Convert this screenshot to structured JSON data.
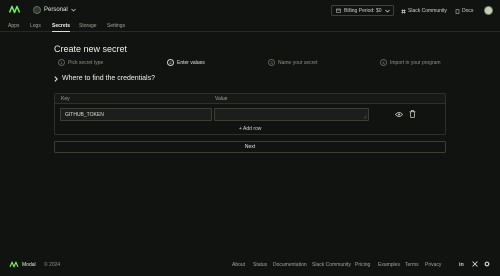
{
  "header": {
    "workspace": "Personal",
    "billing_label": "Billing Period: $0",
    "slack": "Slack Community",
    "docs": "Docs"
  },
  "nav": {
    "tabs": [
      {
        "label": "Apps"
      },
      {
        "label": "Logs"
      },
      {
        "label": "Secrets"
      },
      {
        "label": "Storage"
      },
      {
        "label": "Settings"
      }
    ],
    "active": "Secrets"
  },
  "page": {
    "title": "Create new secret",
    "steps": [
      {
        "num": "1",
        "label": "Pick secret type"
      },
      {
        "num": "2",
        "label": "Enter values"
      },
      {
        "num": "3",
        "label": "Name your secret"
      },
      {
        "num": "4",
        "label": "Import in your program"
      }
    ],
    "active_step": "2",
    "where": "Where to find the credentials?",
    "table": {
      "key_header": "Key",
      "value_header": "Value",
      "rows": [
        {
          "key": "GITHUB_TOKEN",
          "value": ""
        }
      ]
    },
    "add_row": "+ Add row",
    "next": "Next"
  },
  "footer": {
    "brand": "Modal",
    "copyright": "© 2024",
    "links": [
      "About",
      "Status",
      "Documentation",
      "Slack Community",
      "Pricing",
      "Examples",
      "Terms",
      "Privacy"
    ],
    "social": [
      "linkedin-icon",
      "x-icon",
      "github-icon"
    ]
  },
  "colors": {
    "background": "#111311",
    "accent": "#7fee64"
  }
}
